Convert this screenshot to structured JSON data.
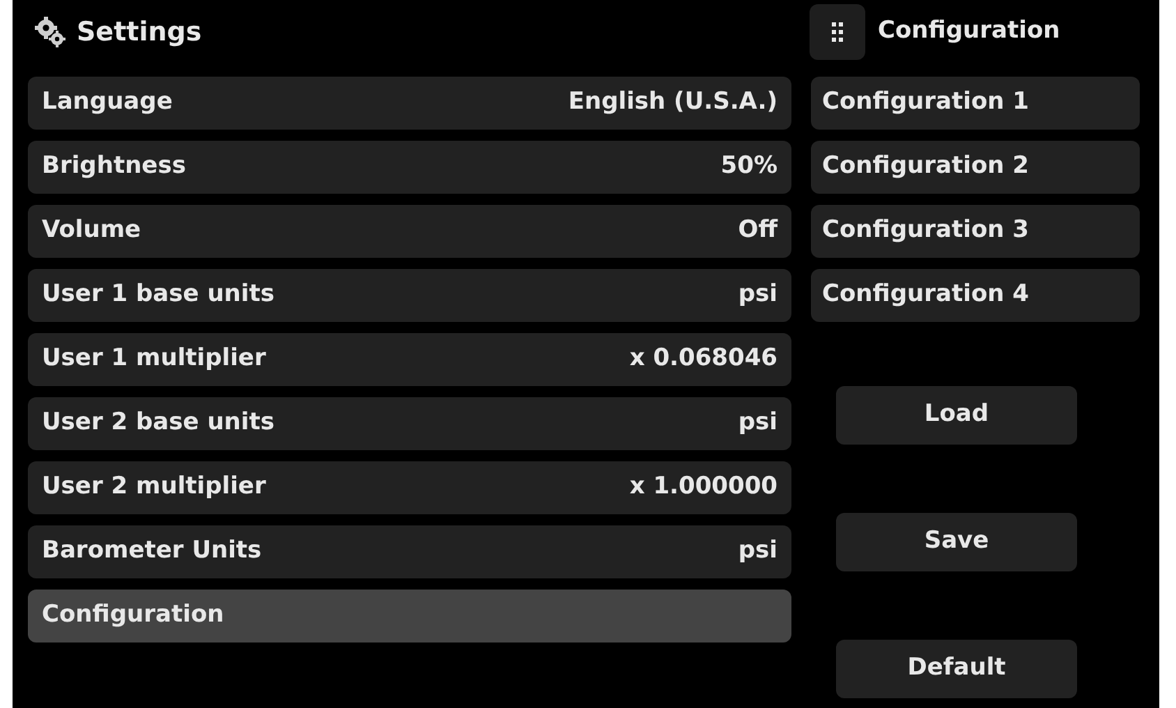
{
  "header": {
    "title": "Settings"
  },
  "panel": {
    "title": "Configuration"
  },
  "settings": [
    {
      "label": "Language",
      "value": "English (U.S.A.)",
      "selected": false
    },
    {
      "label": "Brightness",
      "value": "50%",
      "selected": false
    },
    {
      "label": "Volume",
      "value": "Off",
      "selected": false
    },
    {
      "label": "User 1 base units",
      "value": "psi",
      "selected": false
    },
    {
      "label": "User 1 multiplier",
      "value": "x 0.068046",
      "selected": false
    },
    {
      "label": "User 2 base units",
      "value": "psi",
      "selected": false
    },
    {
      "label": "User 2 multiplier",
      "value": "x 1.000000",
      "selected": false
    },
    {
      "label": "Barometer Units",
      "value": "psi",
      "selected": false
    },
    {
      "label": "Configuration",
      "selected": true
    }
  ],
  "configurations": [
    "Configuration 1",
    "Configuration 2",
    "Configuration 3",
    "Configuration 4"
  ],
  "buttons": [
    "Load",
    "Save",
    "Default"
  ]
}
